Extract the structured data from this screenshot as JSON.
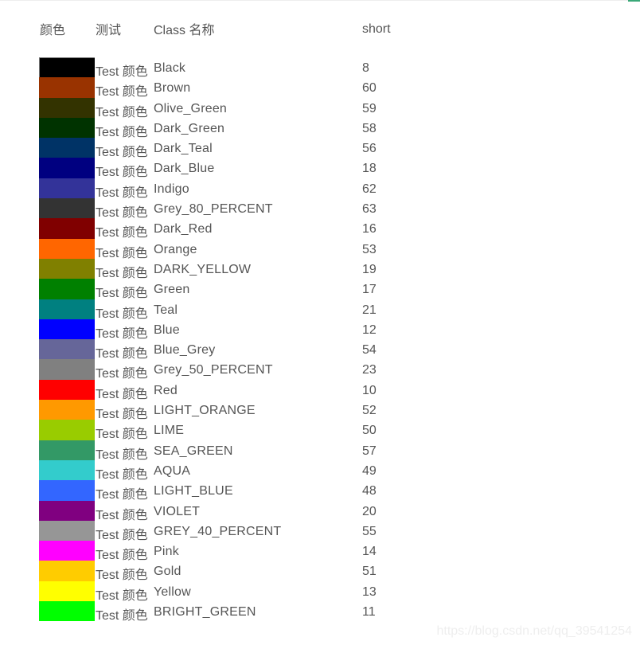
{
  "header": {
    "color": "颜色",
    "test": "测试",
    "class_name": "Class 名称",
    "short": "short"
  },
  "rows": [
    {
      "test": "Test 颜色",
      "name": "Black",
      "short": "8",
      "color": "#000000"
    },
    {
      "test": "Test 颜色",
      "name": "Brown",
      "short": "60",
      "color": "#993300"
    },
    {
      "test": "Test 颜色",
      "name": "Olive_Green",
      "short": "59",
      "color": "#333300"
    },
    {
      "test": "Test 颜色",
      "name": "Dark_Green",
      "short": "58",
      "color": "#003300"
    },
    {
      "test": "Test 颜色",
      "name": "Dark_Teal",
      "short": "56",
      "color": "#003366"
    },
    {
      "test": "Test 颜色",
      "name": "Dark_Blue",
      "short": "18",
      "color": "#000080"
    },
    {
      "test": "Test 颜色",
      "name": "Indigo",
      "short": "62",
      "color": "#333399"
    },
    {
      "test": "Test 颜色",
      "name": "Grey_80_PERCENT",
      "short": "63",
      "color": "#333333"
    },
    {
      "test": "Test 颜色",
      "name": "Dark_Red",
      "short": "16",
      "color": "#800000"
    },
    {
      "test": "Test 颜色",
      "name": "Orange",
      "short": "53",
      "color": "#FF6600"
    },
    {
      "test": "Test 颜色",
      "name": "DARK_YELLOW",
      "short": "19",
      "color": "#808000"
    },
    {
      "test": "Test 颜色",
      "name": "Green",
      "short": "17",
      "color": "#008000"
    },
    {
      "test": "Test 颜色",
      "name": "Teal",
      "short": "21",
      "color": "#008080"
    },
    {
      "test": "Test 颜色",
      "name": "Blue",
      "short": "12",
      "color": "#0000FF"
    },
    {
      "test": "Test 颜色",
      "name": "Blue_Grey",
      "short": "54",
      "color": "#666699"
    },
    {
      "test": "Test 颜色",
      "name": "Grey_50_PERCENT",
      "short": "23",
      "color": "#808080"
    },
    {
      "test": "Test 颜色",
      "name": "Red",
      "short": "10",
      "color": "#FF0000"
    },
    {
      "test": "Test 颜色",
      "name": "LIGHT_ORANGE",
      "short": "52",
      "color": "#FF9900"
    },
    {
      "test": "Test 颜色",
      "name": "LIME",
      "short": "50",
      "color": "#99CC00"
    },
    {
      "test": "Test 颜色",
      "name": "SEA_GREEN",
      "short": "57",
      "color": "#339966"
    },
    {
      "test": "Test 颜色",
      "name": "AQUA",
      "short": "49",
      "color": "#33CCCC"
    },
    {
      "test": "Test 颜色",
      "name": "LIGHT_BLUE",
      "short": "48",
      "color": "#3366FF"
    },
    {
      "test": "Test 颜色",
      "name": "VIOLET",
      "short": "20",
      "color": "#800080"
    },
    {
      "test": "Test 颜色",
      "name": "GREY_40_PERCENT",
      "short": "55",
      "color": "#969696"
    },
    {
      "test": "Test 颜色",
      "name": "Pink",
      "short": "14",
      "color": "#FF00FF"
    },
    {
      "test": "Test 颜色",
      "name": "Gold",
      "short": "51",
      "color": "#FFCC00"
    },
    {
      "test": "Test 颜色",
      "name": "Yellow",
      "short": "13",
      "color": "#FFFF00"
    },
    {
      "test": "Test 颜色",
      "name": "BRIGHT_GREEN",
      "short": "11",
      "color": "#00FF00"
    }
  ],
  "watermark": "https://blog.csdn.net/qq_39541254"
}
